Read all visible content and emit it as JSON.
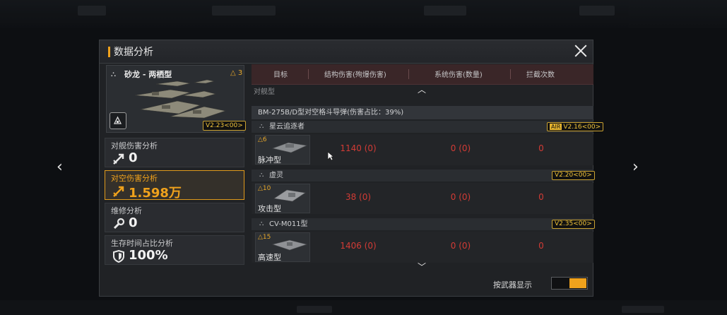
{
  "dialog": {
    "title": "数据分析"
  },
  "ship": {
    "name": "砂龙 - 两栖型",
    "level": "△ 3",
    "version": "V2.23<00>"
  },
  "tabs": [
    {
      "label": "对舰伤害分析",
      "value": "0",
      "icon": "anti-ship-icon"
    },
    {
      "label": "对空伤害分析",
      "value": "1.598万",
      "icon": "anti-air-icon"
    },
    {
      "label": "维修分析",
      "value": "0",
      "icon": "wrench-icon"
    },
    {
      "label": "生存时间占比分析",
      "value": "100%",
      "icon": "shield-icon"
    }
  ],
  "columns": [
    "目标",
    "结构伤害(殉爆伤害)",
    "系统伤害(数量)",
    "拦截次数"
  ],
  "clipped_row": "对舰型",
  "weapon": "BM-275B/D型对空格斗导弹(伤害占比：39%)",
  "groups": [
    {
      "name": "星云追逐者",
      "version": "V2.16<00>",
      "version_tag": "AIR",
      "target": {
        "level": "△6",
        "name": "脉冲型",
        "structure": "1140 (0)",
        "system": "0 (0)",
        "intercept": "0"
      }
    },
    {
      "name": "虚灵",
      "version": "V2.20<00>",
      "version_tag": "",
      "target": {
        "level": "△10",
        "name": "攻击型",
        "structure": "38 (0)",
        "system": "0 (0)",
        "intercept": "0"
      }
    },
    {
      "name": "CV-M011型",
      "version": "V2.35<00>",
      "version_tag": "",
      "target": {
        "level": "△15",
        "name": "高速型",
        "structure": "1406 (0)",
        "system": "0 (0)",
        "intercept": "0"
      }
    }
  ],
  "toggle": {
    "label": "按武器显示",
    "on": true
  },
  "nav": {
    "prev": "‹",
    "next": "›"
  },
  "colors": {
    "accent": "#f0a21c",
    "damage": "#d23b35",
    "header_bg": "#3a2628"
  }
}
